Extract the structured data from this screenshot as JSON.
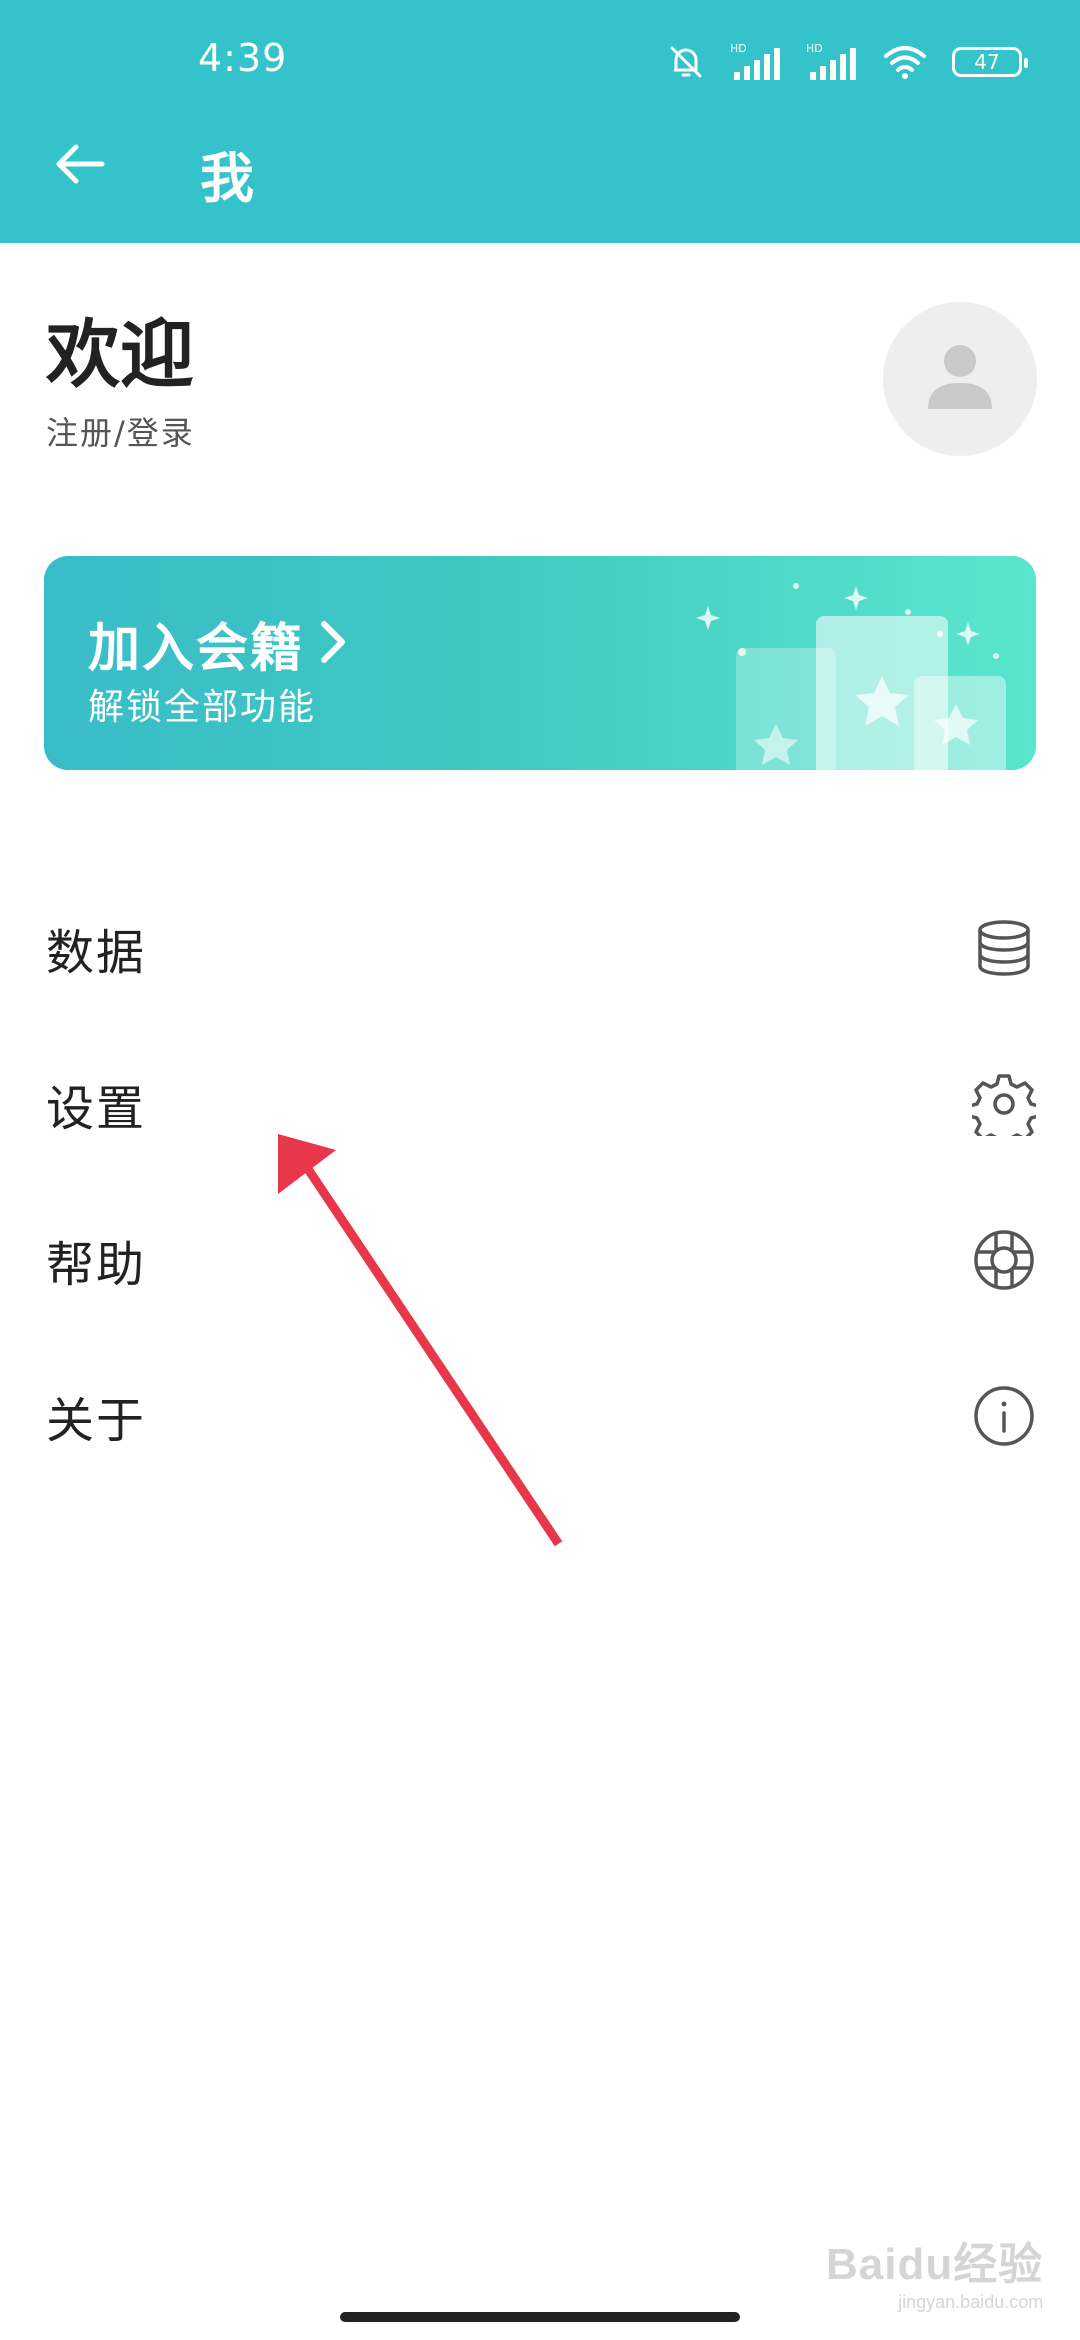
{
  "status_bar": {
    "time": "4:39",
    "battery": "47",
    "signal1_label": "HD",
    "signal2_label": "HD",
    "icons": [
      "bell-off-icon",
      "signal-icon",
      "signal-icon",
      "wifi-icon",
      "battery-icon"
    ]
  },
  "header": {
    "title": "我",
    "back_icon": "back-arrow-icon",
    "background": "#34c3cb"
  },
  "profile": {
    "welcome": "欢迎",
    "login_link": "注册/登录",
    "avatar_icon": "avatar-icon"
  },
  "membership": {
    "title": "加入会籍",
    "subtitle": "解锁全部功能",
    "chevron_icon": "chevron-right-icon"
  },
  "menu": {
    "items": [
      {
        "label": "数据",
        "icon": "database-icon"
      },
      {
        "label": "设置",
        "icon": "gear-icon"
      },
      {
        "label": "帮助",
        "icon": "lifebuoy-icon"
      },
      {
        "label": "关于",
        "icon": "info-icon"
      }
    ]
  },
  "annotation": {
    "arrow_color": "#e8364a"
  },
  "watermark": {
    "text": "Baidu经验",
    "subtext": "jingyan.baidu.com"
  }
}
